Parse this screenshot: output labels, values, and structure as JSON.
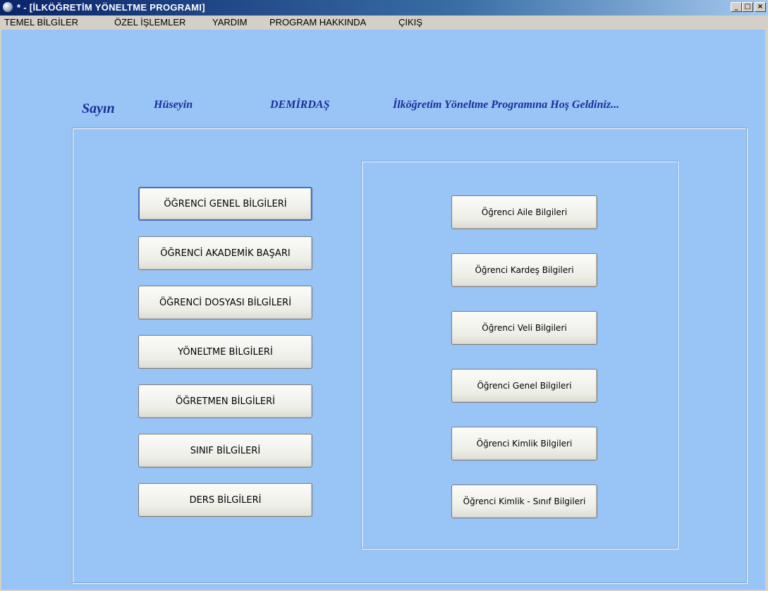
{
  "window": {
    "title": "* - [İLKÖĞRETİM YÖNELTME PROGRAMI]",
    "minimize": "_",
    "maximize": "□",
    "close": "×"
  },
  "menu": [
    "TEMEL BİLGİLER",
    "ÖZEL İŞLEMLER",
    "YARDIM",
    "PROGRAM HAKKINDA",
    "ÇIKIŞ"
  ],
  "welcome": {
    "greeting": "Sayın",
    "first_name": "Hüseyin",
    "last_name": "DEMİRDAŞ",
    "message": "İlköğretim Yöneltme Programına Hoş Geldiniz..."
  },
  "left_buttons": [
    "ÖĞRENCİ GENEL BİLGİLERİ",
    "ÖĞRENCİ AKADEMİK BAŞARI",
    "ÖĞRENCİ DOSYASI BİLGİLERİ",
    "YÖNELTME BİLGİLERİ",
    "ÖĞRETMEN BİLGİLERİ",
    "SINIF BİLGİLERİ",
    "DERS BİLGİLERİ"
  ],
  "right_buttons": [
    "Öğrenci Aile Bilgileri",
    "Öğrenci Kardeş Bilgileri",
    "Öğrenci Veli Bilgileri",
    "Öğrenci Genel Bilgileri",
    "Öğrenci Kimlik Bilgileri",
    "Öğrenci Kimlik - Sınıf Bilgileri"
  ],
  "colors": {
    "background": "#99c4f6",
    "welcome_text": "#1a2e9a",
    "title_bar": "#0a246a"
  }
}
